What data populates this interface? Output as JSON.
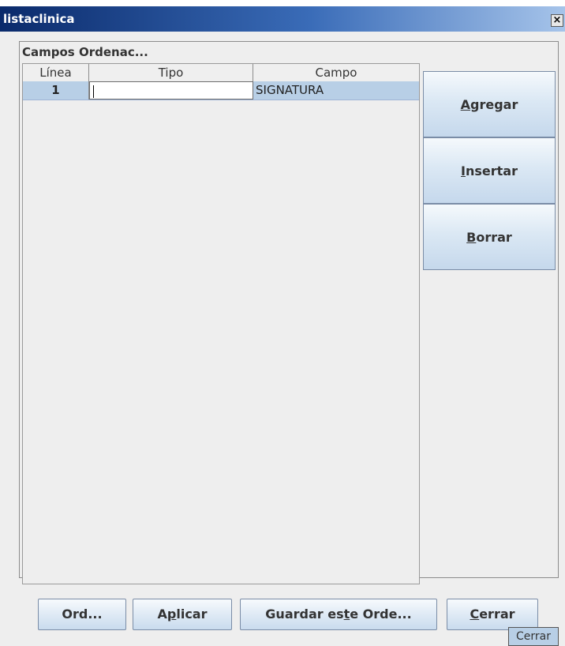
{
  "window": {
    "title": "listaclinica",
    "close_symbol": "×"
  },
  "panel": {
    "title": "Campos Ordenac..."
  },
  "table": {
    "headers": [
      "Línea",
      "Tipo",
      "Campo"
    ],
    "rows": [
      {
        "linea": "1",
        "tipo": "",
        "campo": "SIGNATURA"
      }
    ]
  },
  "side_buttons": {
    "agregar": {
      "pre": "",
      "mnemonic": "A",
      "post": "gregar"
    },
    "insertar": {
      "pre": "",
      "mnemonic": "I",
      "post": "nsertar"
    },
    "borrar": {
      "pre": "",
      "mnemonic": "B",
      "post": "orrar"
    }
  },
  "bottom_buttons": {
    "ord": "Ord...",
    "aplicar": {
      "pre": "A",
      "mnemonic": "p",
      "post": "licar"
    },
    "guardar": {
      "pre": "Guardar es",
      "mnemonic": "t",
      "post": "e Orde..."
    },
    "cerrar": {
      "pre": "",
      "mnemonic": "C",
      "post": "errar"
    }
  },
  "tooltip": {
    "text": "Cerrar"
  },
  "colors": {
    "selection": "#b8cfe6",
    "titlebar_start": "#0a2a6b",
    "titlebar_end": "#a6c4ea"
  }
}
